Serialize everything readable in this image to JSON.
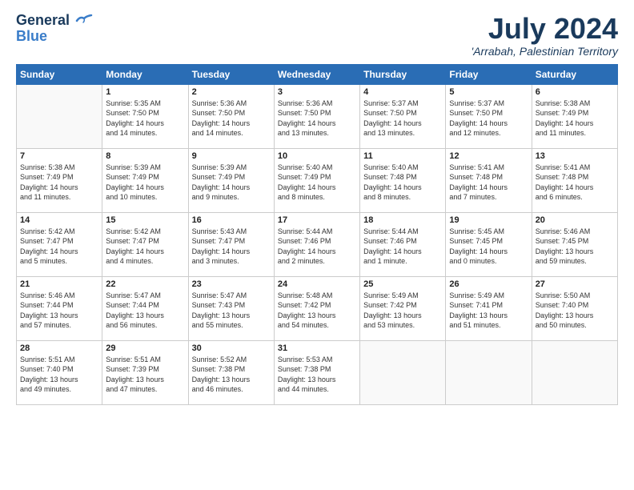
{
  "logo": {
    "line1": "General",
    "line2": "Blue"
  },
  "header": {
    "month": "July 2024",
    "location": "'Arrabah, Palestinian Territory"
  },
  "weekdays": [
    "Sunday",
    "Monday",
    "Tuesday",
    "Wednesday",
    "Thursday",
    "Friday",
    "Saturday"
  ],
  "weeks": [
    [
      {
        "day": "",
        "info": ""
      },
      {
        "day": "1",
        "info": "Sunrise: 5:35 AM\nSunset: 7:50 PM\nDaylight: 14 hours\nand 14 minutes."
      },
      {
        "day": "2",
        "info": "Sunrise: 5:36 AM\nSunset: 7:50 PM\nDaylight: 14 hours\nand 14 minutes."
      },
      {
        "day": "3",
        "info": "Sunrise: 5:36 AM\nSunset: 7:50 PM\nDaylight: 14 hours\nand 13 minutes."
      },
      {
        "day": "4",
        "info": "Sunrise: 5:37 AM\nSunset: 7:50 PM\nDaylight: 14 hours\nand 13 minutes."
      },
      {
        "day": "5",
        "info": "Sunrise: 5:37 AM\nSunset: 7:50 PM\nDaylight: 14 hours\nand 12 minutes."
      },
      {
        "day": "6",
        "info": "Sunrise: 5:38 AM\nSunset: 7:49 PM\nDaylight: 14 hours\nand 11 minutes."
      }
    ],
    [
      {
        "day": "7",
        "info": "Sunrise: 5:38 AM\nSunset: 7:49 PM\nDaylight: 14 hours\nand 11 minutes."
      },
      {
        "day": "8",
        "info": "Sunrise: 5:39 AM\nSunset: 7:49 PM\nDaylight: 14 hours\nand 10 minutes."
      },
      {
        "day": "9",
        "info": "Sunrise: 5:39 AM\nSunset: 7:49 PM\nDaylight: 14 hours\nand 9 minutes."
      },
      {
        "day": "10",
        "info": "Sunrise: 5:40 AM\nSunset: 7:49 PM\nDaylight: 14 hours\nand 8 minutes."
      },
      {
        "day": "11",
        "info": "Sunrise: 5:40 AM\nSunset: 7:48 PM\nDaylight: 14 hours\nand 8 minutes."
      },
      {
        "day": "12",
        "info": "Sunrise: 5:41 AM\nSunset: 7:48 PM\nDaylight: 14 hours\nand 7 minutes."
      },
      {
        "day": "13",
        "info": "Sunrise: 5:41 AM\nSunset: 7:48 PM\nDaylight: 14 hours\nand 6 minutes."
      }
    ],
    [
      {
        "day": "14",
        "info": "Sunrise: 5:42 AM\nSunset: 7:47 PM\nDaylight: 14 hours\nand 5 minutes."
      },
      {
        "day": "15",
        "info": "Sunrise: 5:42 AM\nSunset: 7:47 PM\nDaylight: 14 hours\nand 4 minutes."
      },
      {
        "day": "16",
        "info": "Sunrise: 5:43 AM\nSunset: 7:47 PM\nDaylight: 14 hours\nand 3 minutes."
      },
      {
        "day": "17",
        "info": "Sunrise: 5:44 AM\nSunset: 7:46 PM\nDaylight: 14 hours\nand 2 minutes."
      },
      {
        "day": "18",
        "info": "Sunrise: 5:44 AM\nSunset: 7:46 PM\nDaylight: 14 hours\nand 1 minute."
      },
      {
        "day": "19",
        "info": "Sunrise: 5:45 AM\nSunset: 7:45 PM\nDaylight: 14 hours\nand 0 minutes."
      },
      {
        "day": "20",
        "info": "Sunrise: 5:46 AM\nSunset: 7:45 PM\nDaylight: 13 hours\nand 59 minutes."
      }
    ],
    [
      {
        "day": "21",
        "info": "Sunrise: 5:46 AM\nSunset: 7:44 PM\nDaylight: 13 hours\nand 57 minutes."
      },
      {
        "day": "22",
        "info": "Sunrise: 5:47 AM\nSunset: 7:44 PM\nDaylight: 13 hours\nand 56 minutes."
      },
      {
        "day": "23",
        "info": "Sunrise: 5:47 AM\nSunset: 7:43 PM\nDaylight: 13 hours\nand 55 minutes."
      },
      {
        "day": "24",
        "info": "Sunrise: 5:48 AM\nSunset: 7:42 PM\nDaylight: 13 hours\nand 54 minutes."
      },
      {
        "day": "25",
        "info": "Sunrise: 5:49 AM\nSunset: 7:42 PM\nDaylight: 13 hours\nand 53 minutes."
      },
      {
        "day": "26",
        "info": "Sunrise: 5:49 AM\nSunset: 7:41 PM\nDaylight: 13 hours\nand 51 minutes."
      },
      {
        "day": "27",
        "info": "Sunrise: 5:50 AM\nSunset: 7:40 PM\nDaylight: 13 hours\nand 50 minutes."
      }
    ],
    [
      {
        "day": "28",
        "info": "Sunrise: 5:51 AM\nSunset: 7:40 PM\nDaylight: 13 hours\nand 49 minutes."
      },
      {
        "day": "29",
        "info": "Sunrise: 5:51 AM\nSunset: 7:39 PM\nDaylight: 13 hours\nand 47 minutes."
      },
      {
        "day": "30",
        "info": "Sunrise: 5:52 AM\nSunset: 7:38 PM\nDaylight: 13 hours\nand 46 minutes."
      },
      {
        "day": "31",
        "info": "Sunrise: 5:53 AM\nSunset: 7:38 PM\nDaylight: 13 hours\nand 44 minutes."
      },
      {
        "day": "",
        "info": ""
      },
      {
        "day": "",
        "info": ""
      },
      {
        "day": "",
        "info": ""
      }
    ]
  ]
}
